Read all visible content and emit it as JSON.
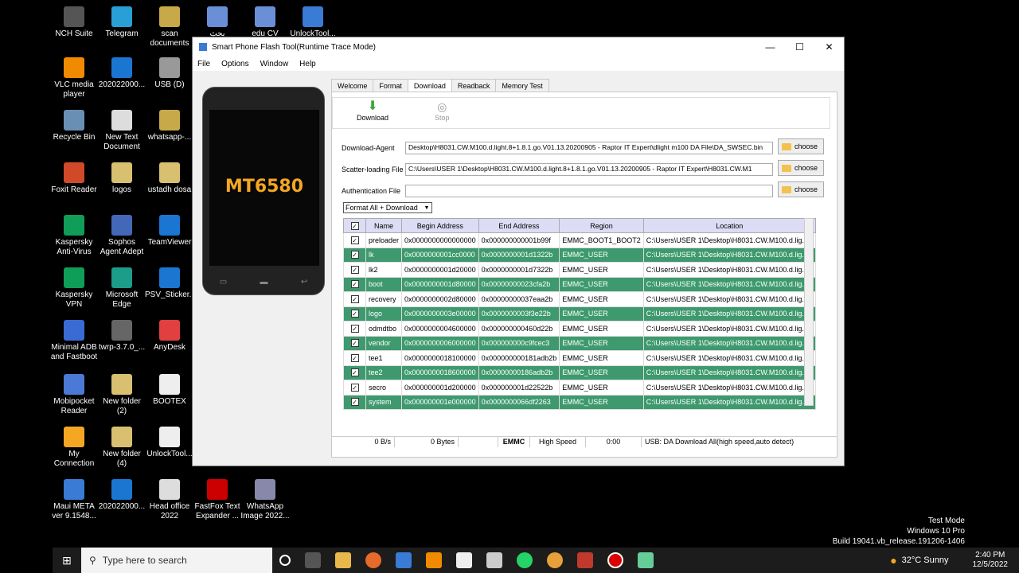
{
  "desktop": {
    "icons": [
      {
        "label": "NCH Suite",
        "x": 0
      },
      {
        "label": "Telegram"
      },
      {
        "label": "scan documents"
      },
      {
        "label": "بحث"
      },
      {
        "label": "edu CV"
      },
      {
        "label": "UnlockTool..."
      },
      {
        "label": "VLC media player"
      },
      {
        "label": "202022000..."
      },
      {
        "label": "USB (D)"
      },
      {
        "label": "Recycle Bin"
      },
      {
        "label": "New Text Document"
      },
      {
        "label": "whatsapp-..."
      },
      {
        "label": "Foxit Reader"
      },
      {
        "label": "logos"
      },
      {
        "label": "ustadh dosa"
      },
      {
        "label": "Kaspersky Anti-Virus"
      },
      {
        "label": "Sophos Agent Adept"
      },
      {
        "label": "TeamViewer"
      },
      {
        "label": "Kaspersky VPN"
      },
      {
        "label": "Microsoft Edge"
      },
      {
        "label": "PSV_Sticker..."
      },
      {
        "label": "Minimal ADB and Fastboot"
      },
      {
        "label": "twrp-3.7.0_..."
      },
      {
        "label": "AnyDesk"
      },
      {
        "label": "Mobipocket Reader"
      },
      {
        "label": "New folder (2)"
      },
      {
        "label": "BOOTEX"
      },
      {
        "label": "My Connection"
      },
      {
        "label": "New folder (4)"
      },
      {
        "label": "UnlockTool..."
      },
      {
        "label": "Maui META ver 9.1548..."
      },
      {
        "label": "202022000..."
      },
      {
        "label": "Head office 2022"
      },
      {
        "label": "FastFox Text Expander ..."
      },
      {
        "label": "WhatsApp Image 2022..."
      }
    ]
  },
  "window": {
    "title": "Smart Phone Flash Tool(Runtime Trace Mode)",
    "controls": {
      "min": "—",
      "max": "☐",
      "close": "✕"
    },
    "menu": [
      "File",
      "Options",
      "Window",
      "Help"
    ],
    "phone_chip": "MT6580",
    "tabs": [
      "Welcome",
      "Format",
      "Download",
      "Readback",
      "Memory Test"
    ],
    "toolbar": {
      "download": "Download",
      "stop": "Stop"
    },
    "fields": {
      "download_agent_label": "Download-Agent",
      "download_agent_value": "Desktop\\H8031.CW.M100.d.light.8+1.8.1.go.V01.13.20200905 - Raptor IT Expert\\dlight m100 DA File\\DA_SWSEC.bin",
      "scatter_label": "Scatter-loading File",
      "scatter_value": "C:\\Users\\USER 1\\Desktop\\H8031.CW.M100.d.light.8+1.8.1.go.V01.13.20200905 - Raptor IT Expert\\H8031.CW.M1",
      "auth_label": "Authentication File",
      "auth_value": "",
      "choose": "choose"
    },
    "mode": "Format All + Download",
    "table": {
      "headers": [
        "Name",
        "Begin Address",
        "End Address",
        "Region",
        "Location"
      ],
      "rows": [
        [
          "preloader",
          "0x0000000000000000",
          "0x000000000001b99f",
          "EMMC_BOOT1_BOOT2",
          "C:\\Users\\USER 1\\Desktop\\H8031.CW.M100.d.lig..."
        ],
        [
          "lk",
          "0x0000000001cc0000",
          "0x0000000001d1322b",
          "EMMC_USER",
          "C:\\Users\\USER 1\\Desktop\\H8031.CW.M100.d.lig..."
        ],
        [
          "lk2",
          "0x0000000001d20000",
          "0x0000000001d7322b",
          "EMMC_USER",
          "C:\\Users\\USER 1\\Desktop\\H8031.CW.M100.d.lig..."
        ],
        [
          "boot",
          "0x0000000001d80000",
          "0x00000000023cfa2b",
          "EMMC_USER",
          "C:\\Users\\USER 1\\Desktop\\H8031.CW.M100.d.lig..."
        ],
        [
          "recovery",
          "0x0000000002d80000",
          "0x00000000037eaa2b",
          "EMMC_USER",
          "C:\\Users\\USER 1\\Desktop\\H8031.CW.M100.d.lig..."
        ],
        [
          "logo",
          "0x0000000003e00000",
          "0x0000000003f3e22b",
          "EMMC_USER",
          "C:\\Users\\USER 1\\Desktop\\H8031.CW.M100.d.lig..."
        ],
        [
          "odmdtbo",
          "0x0000000004600000",
          "0x000000000460d22b",
          "EMMC_USER",
          "C:\\Users\\USER 1\\Desktop\\H8031.CW.M100.d.lig..."
        ],
        [
          "vendor",
          "0x0000000006000000",
          "0x000000000c9fcec3",
          "EMMC_USER",
          "C:\\Users\\USER 1\\Desktop\\H8031.CW.M100.d.lig..."
        ],
        [
          "tee1",
          "0x0000000018100000",
          "0x000000000181adb2b",
          "EMMC_USER",
          "C:\\Users\\USER 1\\Desktop\\H8031.CW.M100.d.lig..."
        ],
        [
          "tee2",
          "0x0000000018600000",
          "0x00000000186adb2b",
          "EMMC_USER",
          "C:\\Users\\USER 1\\Desktop\\H8031.CW.M100.d.lig..."
        ],
        [
          "secro",
          "0x000000001d200000",
          "0x000000001d22522b",
          "EMMC_USER",
          "C:\\Users\\USER 1\\Desktop\\H8031.CW.M100.d.lig..."
        ],
        [
          "system",
          "0x000000001e000000",
          "0x0000000066df2263",
          "EMMC_USER",
          "C:\\Users\\USER 1\\Desktop\\H8031.CW.M100.d.lig..."
        ]
      ]
    },
    "status": {
      "speed": "0 B/s",
      "bytes": "0 Bytes",
      "storage": "EMMC",
      "mode": "High Speed",
      "time": "0:00",
      "usb": "USB: DA Download All(high speed,auto detect)"
    }
  },
  "watermark": {
    "line1": "Test Mode",
    "line2": "Windows 10 Pro",
    "line3": "Build 19041.vb_release.191206-1406"
  },
  "taskbar": {
    "search_placeholder": "Type here to search",
    "weather": "32°C  Sunny",
    "time": "2:40 PM",
    "date": "12/5/2022"
  },
  "colors": {
    "row_green": "#3e9a6e",
    "chip": "#f5a623"
  }
}
